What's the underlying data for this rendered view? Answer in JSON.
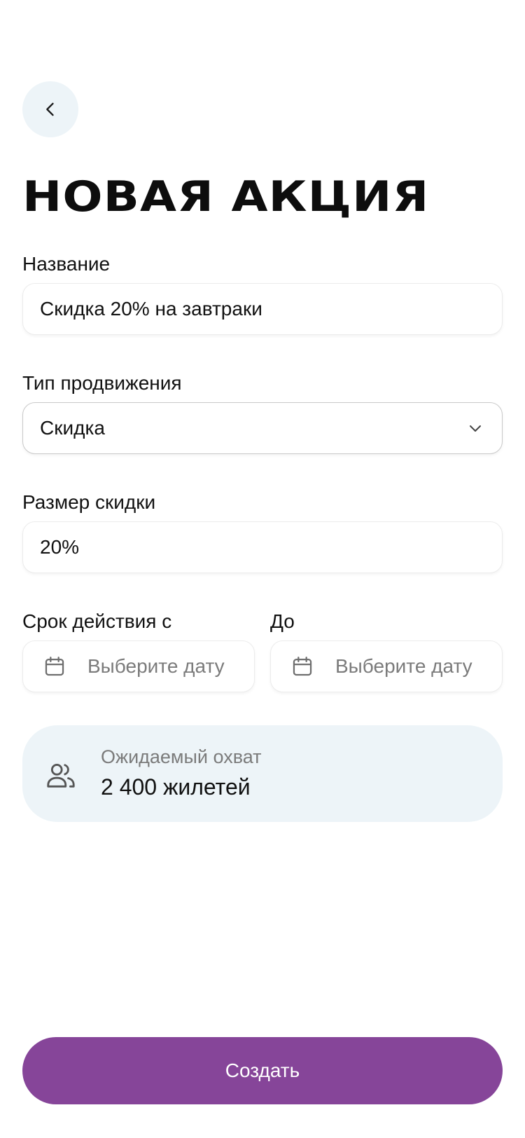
{
  "header": {
    "back_icon": "chevron-left-icon",
    "title": "НОВАЯ АКЦИЯ"
  },
  "form": {
    "name": {
      "label": "Название",
      "value": "Скидка 20% на завтраки"
    },
    "promo_type": {
      "label": "Тип продвижения",
      "value": "Скидка",
      "icon": "chevron-down-icon"
    },
    "discount_size": {
      "label": "Размер скидки",
      "value": "20%"
    },
    "valid_from": {
      "label": "Срок действия с",
      "placeholder": "Выберите дату",
      "icon": "calendar-icon"
    },
    "valid_to": {
      "label": "До",
      "placeholder": "Выберите дату",
      "icon": "calendar-icon"
    }
  },
  "reach": {
    "icon": "users-icon",
    "label": "Ожидаемый охват",
    "value": "2 400 жилетей"
  },
  "submit": {
    "label": "Создать"
  },
  "colors": {
    "accent": "#864599",
    "soft_panel": "#edf4f8",
    "muted_text": "#7b7b7b"
  }
}
